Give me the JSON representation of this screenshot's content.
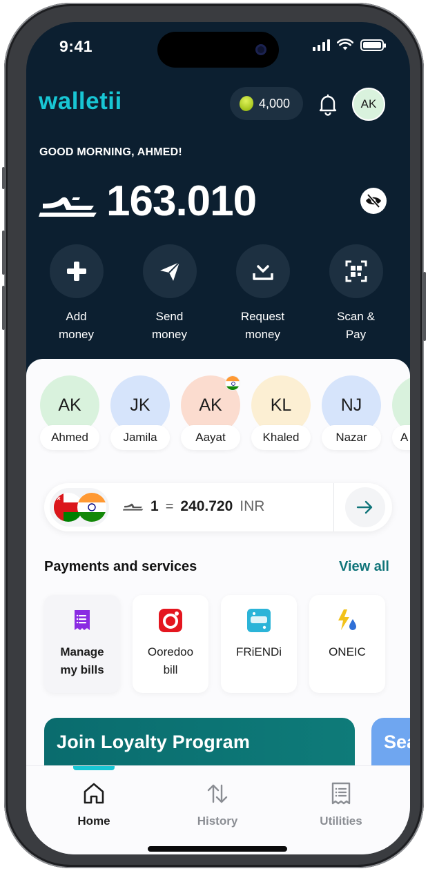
{
  "status_bar": {
    "time": "9:41"
  },
  "header": {
    "logo": "walletii",
    "points": "4,000",
    "avatar_initials": "AK"
  },
  "greeting": "GOOD MORNING, AHMED!",
  "balance": {
    "amount": "163.010",
    "currency_icon": "omani-rial-symbol"
  },
  "quick_actions": [
    {
      "label_line1": "Add",
      "label_line2": "money",
      "icon": "plus-icon"
    },
    {
      "label_line1": "Send",
      "label_line2": "money",
      "icon": "paper-plane-icon"
    },
    {
      "label_line1": "Request",
      "label_line2": "money",
      "icon": "inbox-download-icon"
    },
    {
      "label_line1": "Scan &",
      "label_line2": "Pay",
      "icon": "qr-scan-icon"
    }
  ],
  "contacts": [
    {
      "initials": "AK",
      "name": "Ahmed",
      "color": "#d9f2dd"
    },
    {
      "initials": "JK",
      "name": "Jamila",
      "color": "#d6e4fb"
    },
    {
      "initials": "AK",
      "name": "Aayat",
      "color": "#fbdccf",
      "flag": "india"
    },
    {
      "initials": "KL",
      "name": "Khaled",
      "color": "#fcefd3"
    },
    {
      "initials": "NJ",
      "name": "Nazar",
      "color": "#d6e4fb"
    },
    {
      "initials": "",
      "name": "A",
      "color": "#d9f2dd"
    }
  ],
  "exchange_rate": {
    "from_amount": "1",
    "equals": "=",
    "to_amount": "240.720",
    "to_currency": "INR"
  },
  "services_section": {
    "title": "Payments and services",
    "view_all": "View all",
    "items": [
      {
        "label_line1": "Manage",
        "label_line2": "my bills",
        "icon": "bill-icon"
      },
      {
        "label_line1": "Ooredoo",
        "label_line2": "bill",
        "icon": "ooredoo-icon"
      },
      {
        "label_line1": "FRiENDi",
        "label_line2": "",
        "icon": "friendi-icon"
      },
      {
        "label_line1": "ONEIC",
        "label_line2": "",
        "icon": "oneic-icon"
      }
    ]
  },
  "promos": [
    {
      "title": "Join Loyalty Program"
    },
    {
      "title": "Sea"
    }
  ],
  "tabbar": {
    "tabs": [
      {
        "label": "Home",
        "icon": "home-icon",
        "active": true
      },
      {
        "label": "History",
        "icon": "history-arrows-icon",
        "active": false
      },
      {
        "label": "Utilities",
        "icon": "receipt-icon",
        "active": false
      }
    ]
  },
  "colors": {
    "brand": "#18c6d4",
    "header_bg": "#0c1f30",
    "accent_link": "#0f7479"
  }
}
